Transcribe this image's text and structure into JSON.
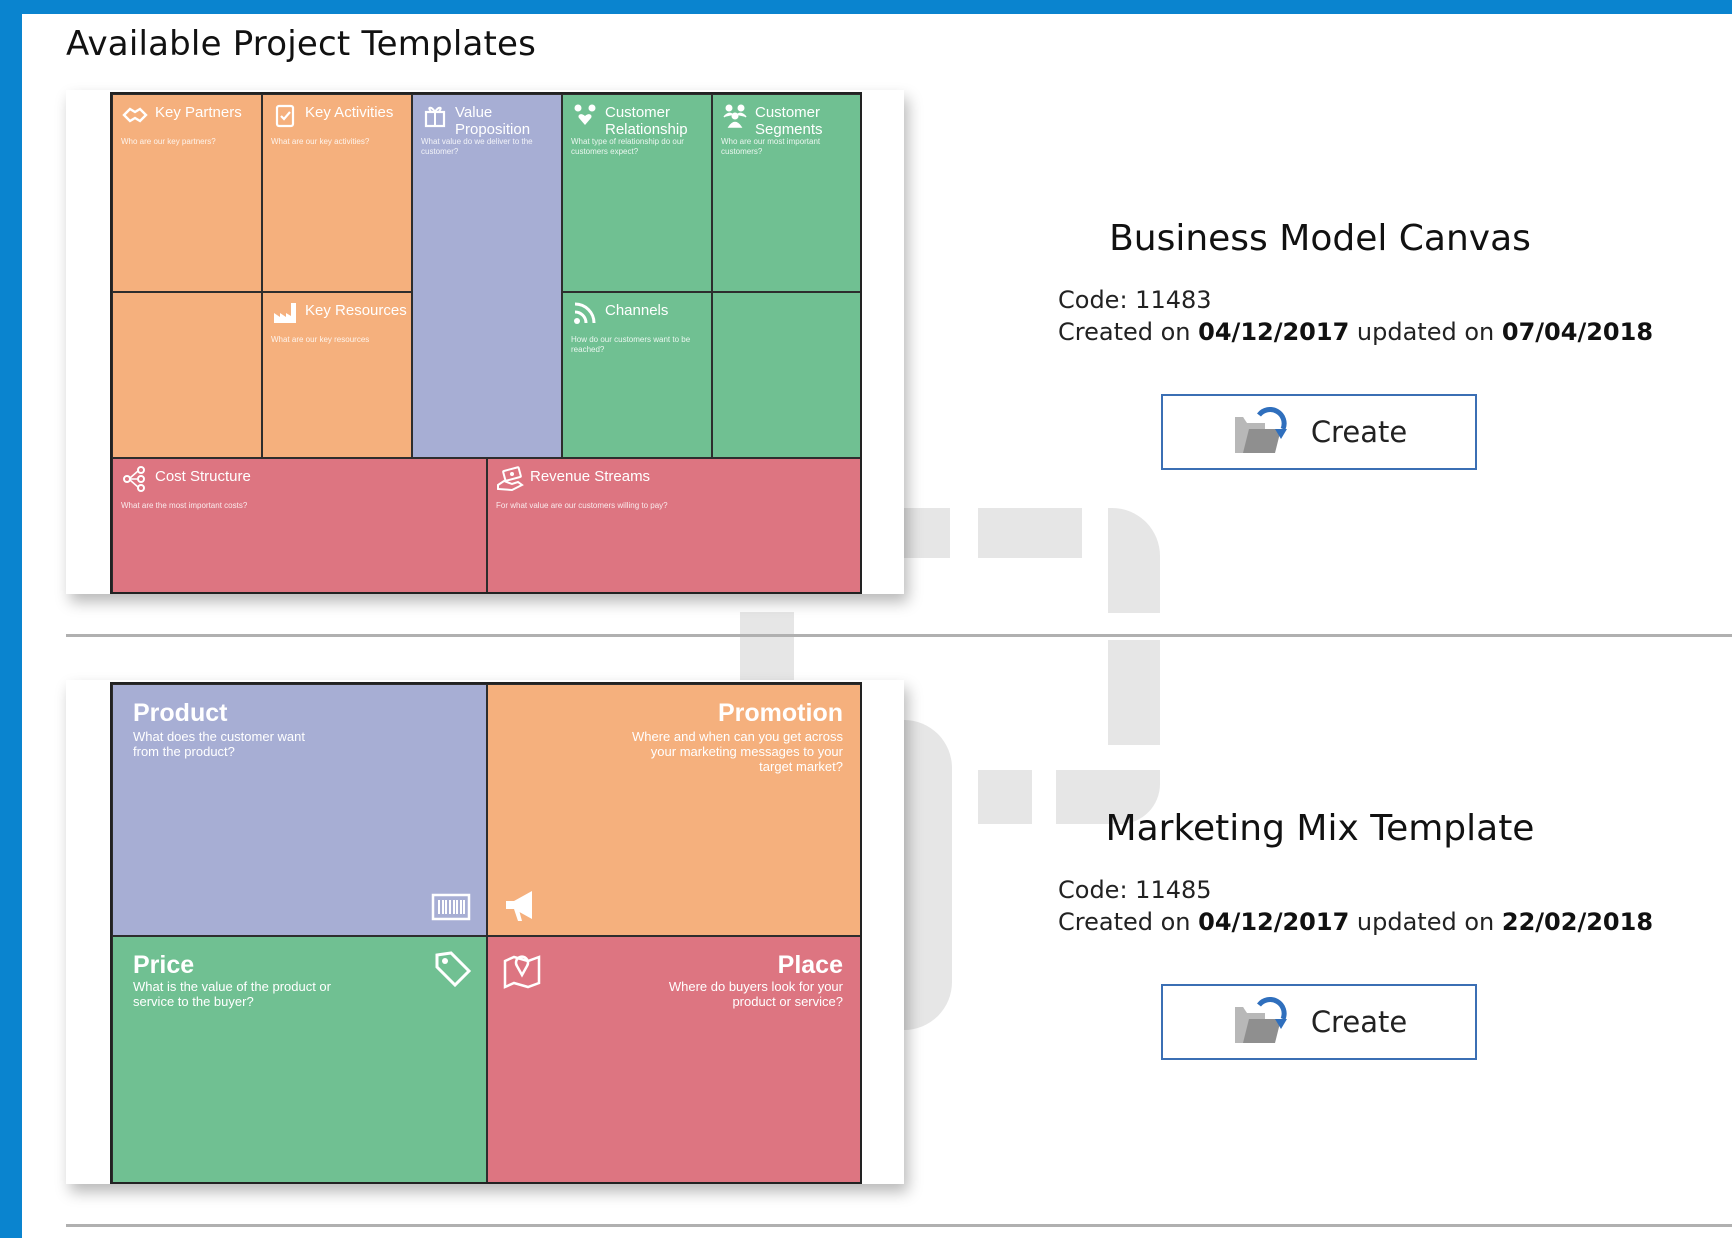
{
  "page": {
    "title": "Available Project Templates"
  },
  "colors": {
    "accent": "#0a84cf",
    "orange": "#f5b07d",
    "purple": "#a7aed4",
    "green": "#70c092",
    "red": "#dd7581",
    "button_border": "#3b6fb4"
  },
  "templates": [
    {
      "name": "Business Model Canvas",
      "code_label": "Code:",
      "code": "11483",
      "created_label": "Created on",
      "created": "04/12/2017",
      "updated_label": "updated on",
      "updated": "07/04/2018",
      "button_label": "Create",
      "button_icon": "folder-refresh-icon",
      "preview": {
        "key_partners": {
          "title": "Key Partners",
          "sub": "Who are our key partners?",
          "icon": "handshake-icon"
        },
        "key_activities": {
          "title": "Key Activities",
          "sub": "What are our key activities?",
          "icon": "clipboard-check-icon"
        },
        "value_proposition": {
          "title": "Value Proposition",
          "sub": "What value do we deliver to the customer?",
          "icon": "gift-icon"
        },
        "customer_relationship": {
          "title": "Customer Relationship",
          "sub": "What type of relationship do our customers expect?",
          "icon": "people-heart-icon"
        },
        "customer_segments": {
          "title": "Customer Segments",
          "sub": "Who are our most important customers?",
          "icon": "people-group-icon"
        },
        "key_resources": {
          "title": "Key Resources",
          "sub": "What are our key resources",
          "icon": "factory-icon"
        },
        "channels": {
          "title": "Channels",
          "sub": "How do our customers want to be reached?",
          "icon": "rss-icon"
        },
        "cost_structure": {
          "title": "Cost Structure",
          "sub": "What are the most important costs?",
          "icon": "share-nodes-icon"
        },
        "revenue_streams": {
          "title": "Revenue Streams",
          "sub": "For what value are our customers willing to pay?",
          "icon": "money-hand-icon"
        }
      }
    },
    {
      "name": "Marketing Mix Template",
      "code_label": "Code:",
      "code": "11485",
      "created_label": "Created on",
      "created": "04/12/2017",
      "updated_label": "updated on",
      "updated": "22/02/2018",
      "button_label": "Create",
      "button_icon": "folder-refresh-icon",
      "preview": {
        "product": {
          "title": "Product",
          "sub": "What does the customer want from the product?",
          "icon": "barcode-icon"
        },
        "promotion": {
          "title": "Promotion",
          "sub": "Where and when can you get across your marketing messages to your target market?",
          "icon": "megaphone-icon"
        },
        "price": {
          "title": "Price",
          "sub": "What is the value of the product or service to the buyer?",
          "icon": "price-tag-icon"
        },
        "place": {
          "title": "Place",
          "sub": "Where do buyers look for your product or service?",
          "icon": "map-pin-icon"
        }
      }
    }
  ]
}
